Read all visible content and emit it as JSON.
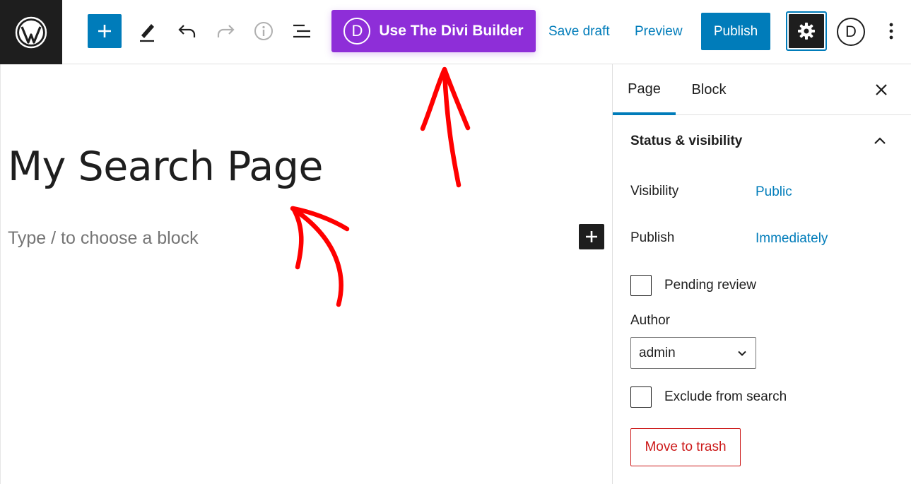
{
  "toolbar": {
    "divi_button_label": "Use The Divi Builder",
    "divi_badge": "D",
    "save_draft_label": "Save draft",
    "preview_label": "Preview",
    "publish_label": "Publish",
    "divi_icon_letter": "D",
    "icons": [
      "wordpress-logo-icon",
      "plus-icon",
      "pencil-icon",
      "undo-icon",
      "redo-icon",
      "info-icon",
      "list-view-icon",
      "gear-icon",
      "more-vertical-icon"
    ]
  },
  "editor": {
    "title": "My Search Page",
    "block_placeholder": "Type / to choose a block"
  },
  "sidebar": {
    "tabs": [
      {
        "label": "Page",
        "active": true
      },
      {
        "label": "Block",
        "active": false
      }
    ],
    "panel_title": "Status & visibility",
    "visibility_label": "Visibility",
    "visibility_value": "Public",
    "publish_label": "Publish",
    "publish_value": "Immediately",
    "pending_review_label": "Pending review",
    "author_label": "Author",
    "author_value": "admin",
    "exclude_search_label": "Exclude from search",
    "trash_label": "Move to trash"
  },
  "colors": {
    "accent": "#007cba",
    "divi_purple": "#8e2ed8",
    "danger": "#cc1818",
    "annotation": "#ff0000"
  }
}
